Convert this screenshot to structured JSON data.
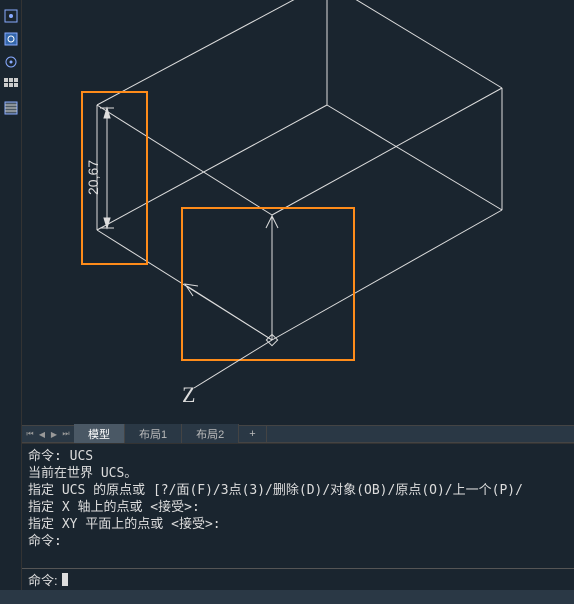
{
  "tabs": {
    "model": "模型",
    "layout1": "布局1",
    "layout2": "布局2",
    "plus": "+"
  },
  "dimension": {
    "value": "20,67"
  },
  "axis": {
    "z_label": "Z"
  },
  "cmd_history": {
    "l1": "命令: UCS",
    "l2": "当前在世界 UCS。",
    "l3": "指定 UCS 的原点或 [?/面(F)/3点(3)/删除(D)/对象(OB)/原点(O)/上一个(P)/",
    "l4": "指定 X 轴上的点或 <接受>:",
    "l5": "指定 XY 平面上的点或 <接受>:",
    "l6": "命令:"
  },
  "cmd_input": {
    "prompt": "命令: "
  },
  "colors": {
    "highlight": "#ff8c1a",
    "line": "#dddddd"
  }
}
